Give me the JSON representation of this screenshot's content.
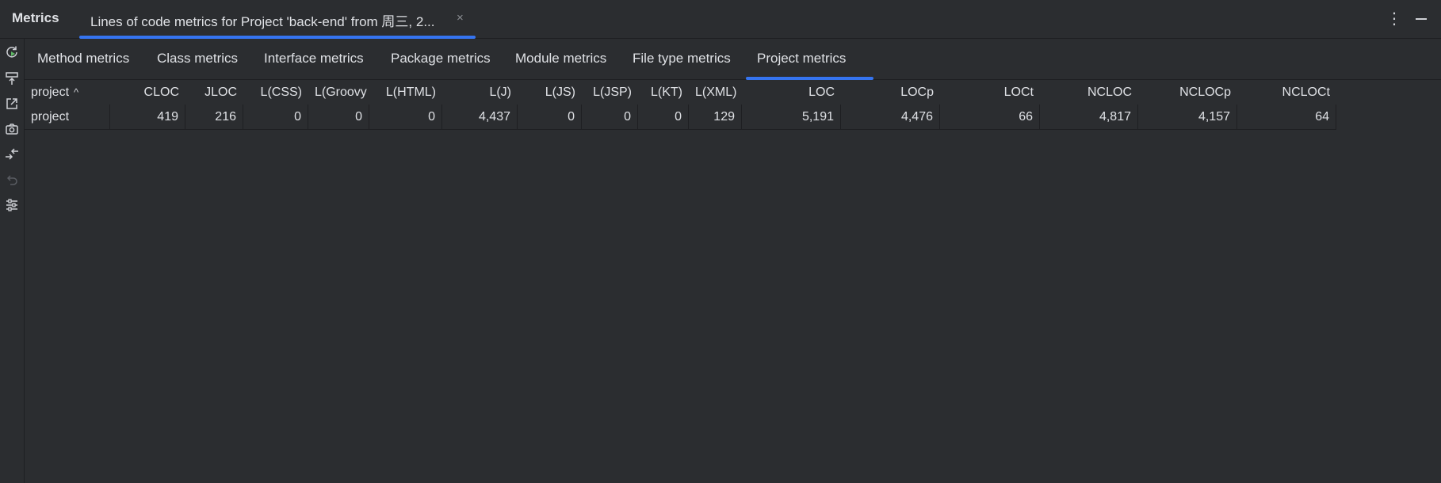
{
  "titlebar": {
    "tool_title": "Metrics",
    "content_tab_label": "Lines of code metrics for Project 'back-end' from 周三, 2...",
    "content_tab_close": "×",
    "more_glyph": "⋮"
  },
  "left_toolbar": [
    {
      "name": "rerun-icon"
    },
    {
      "name": "export-icon"
    },
    {
      "name": "open-in-editor-icon"
    },
    {
      "name": "snapshot-icon"
    },
    {
      "name": "compare-icon"
    },
    {
      "name": "undo-icon"
    },
    {
      "name": "settings-icon"
    }
  ],
  "tabs": [
    {
      "label": "Method metrics",
      "active": false
    },
    {
      "label": "Class metrics",
      "active": false
    },
    {
      "label": "Interface metrics",
      "active": false
    },
    {
      "label": "Package metrics",
      "active": false
    },
    {
      "label": "Module metrics",
      "active": false
    },
    {
      "label": "File type metrics",
      "active": false
    },
    {
      "label": "Project metrics",
      "active": true
    }
  ],
  "table": {
    "sort_indicator": "^",
    "columns": [
      "project",
      "CLOC",
      "JLOC",
      "L(CSS)",
      "L(Groovy",
      "L(HTML)",
      "L(J)",
      "L(JS)",
      "L(JSP)",
      "L(KT)",
      "L(XML)",
      "LOC",
      "LOCp",
      "LOCt",
      "NCLOC",
      "NCLOCp",
      "NCLOCt"
    ],
    "rows": [
      [
        "project",
        "419",
        "216",
        "0",
        "0",
        "0",
        "4,437",
        "0",
        "0",
        "0",
        "129",
        "5,191",
        "4,476",
        "66",
        "4,817",
        "4,157",
        "64"
      ]
    ]
  },
  "colors": {
    "background": "#2b2d30",
    "accent": "#3574f0",
    "text": "#dfe1e5",
    "border": "#1e1f22"
  }
}
